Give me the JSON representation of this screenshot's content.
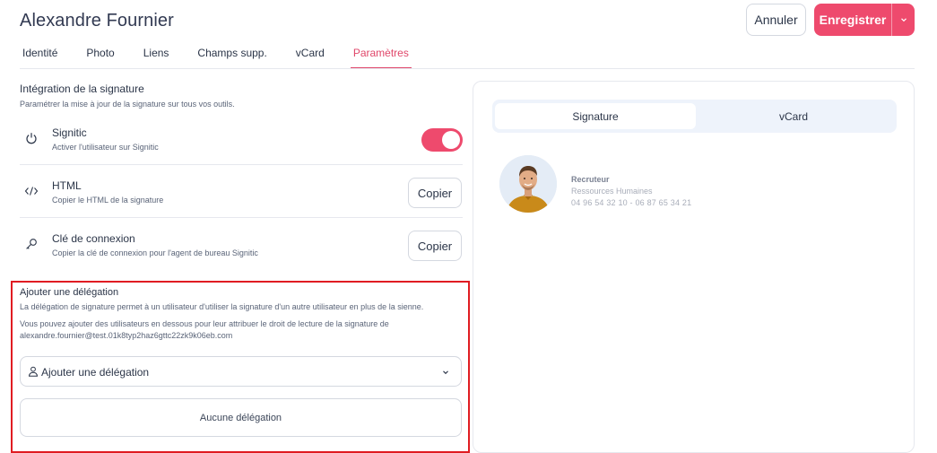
{
  "header": {
    "title": "Alexandre Fournier",
    "cancel_label": "Annuler",
    "save_label": "Enregistrer"
  },
  "tabs": [
    {
      "label": "Identité",
      "active": false
    },
    {
      "label": "Photo",
      "active": false
    },
    {
      "label": "Liens",
      "active": false
    },
    {
      "label": "Champs supp.",
      "active": false
    },
    {
      "label": "vCard",
      "active": false
    },
    {
      "label": "Paramètres",
      "active": true
    }
  ],
  "integration": {
    "title": "Intégration de la signature",
    "subtitle": "Paramétrer la mise à jour de la signature sur tous vos outils.",
    "rows": [
      {
        "icon": "power-icon",
        "title": "Signitic",
        "desc": "Activer l'utilisateur sur Signitic",
        "control": "toggle",
        "enabled": true
      },
      {
        "icon": "code-icon",
        "title": "HTML",
        "desc": "Copier le HTML de la signature",
        "control": "button",
        "button_label": "Copier"
      },
      {
        "icon": "key-icon",
        "title": "Clé de connexion",
        "desc": "Copier la clé de connexion pour l'agent de bureau Signitic",
        "control": "button",
        "button_label": "Copier"
      }
    ]
  },
  "delegation": {
    "title": "Ajouter une délégation",
    "text1": "La délégation de signature permet à un utilisateur d'utiliser la signature d'un autre utilisateur en plus de la sienne.",
    "text2": "Vous pouvez ajouter des utilisateurs en dessous pour leur attribuer le droit de lecture de la signature de alexandre.fournier@test.01k8typ2haz6gttc22zk9k06eb.com",
    "select_placeholder": "Ajouter une délégation",
    "empty_label": "Aucune délégation"
  },
  "preview": {
    "tabs": [
      {
        "label": "Signature",
        "active": true
      },
      {
        "label": "vCard",
        "active": false
      }
    ],
    "role": "Recruteur",
    "department": "Ressources Humaines",
    "phones": "04 96 54 32 10 - 06 87 65 34 21"
  },
  "colors": {
    "accent": "#ee4a6d",
    "highlight_border": "#e01c22"
  }
}
